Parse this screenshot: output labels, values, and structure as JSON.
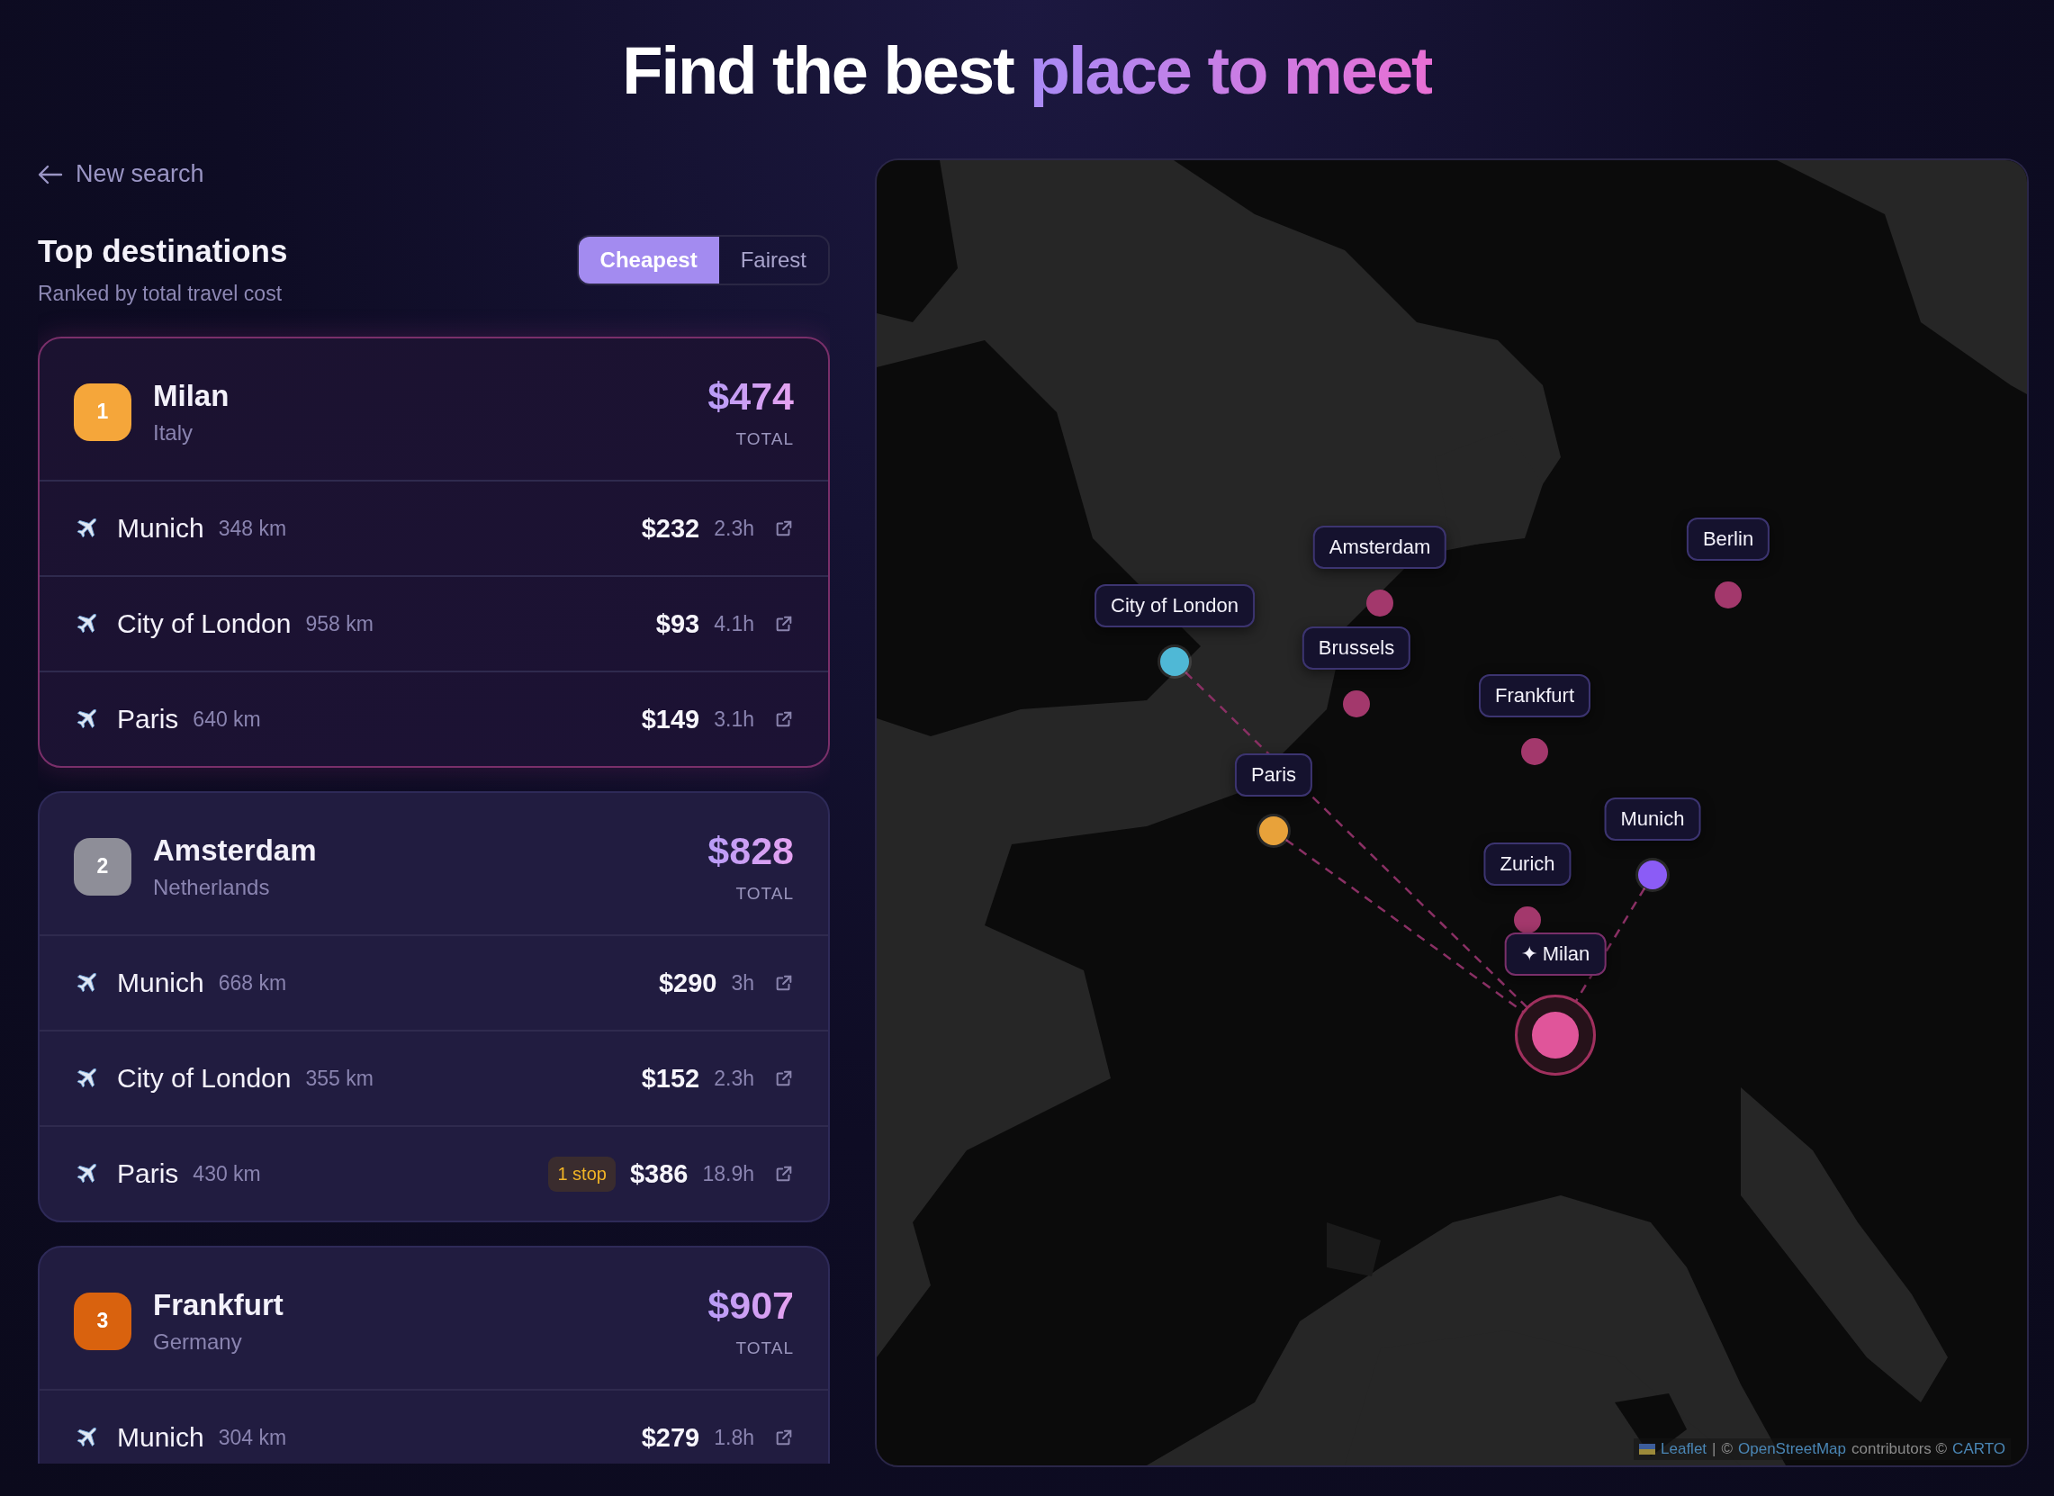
{
  "header": {
    "title": "Find the best",
    "highlight": "place to meet"
  },
  "sidebar": {
    "back_link": "New search",
    "heading": "Top destinations",
    "subheading": "Ranked by total travel cost",
    "sort_tabs": [
      {
        "label": "Cheapest",
        "selected": true
      },
      {
        "label": "Fairest",
        "selected": false
      }
    ],
    "destinations": [
      {
        "rank": "1",
        "color": "#f5a63a",
        "city": "Milan",
        "country": "Italy",
        "total": "$474",
        "total_label": "TOTAL",
        "selected": true,
        "legs": [
          {
            "city": "Munich",
            "distance": "348 km",
            "price": "$232",
            "duration": "2.3h"
          },
          {
            "city": "City of London",
            "distance": "958 km",
            "price": "$93",
            "duration": "4.1h"
          },
          {
            "city": "Paris",
            "distance": "640 km",
            "price": "$149",
            "duration": "3.1h"
          }
        ]
      },
      {
        "rank": "2",
        "color": "#8e8e98",
        "city": "Amsterdam",
        "country": "Netherlands",
        "total": "$828",
        "total_label": "TOTAL",
        "selected": false,
        "legs": [
          {
            "city": "Munich",
            "distance": "668 km",
            "price": "$290",
            "duration": "3h"
          },
          {
            "city": "City of London",
            "distance": "355 km",
            "price": "$152",
            "duration": "2.3h"
          },
          {
            "city": "Paris",
            "distance": "430 km",
            "stops": "1 stop",
            "price": "$386",
            "duration": "18.9h"
          }
        ]
      },
      {
        "rank": "3",
        "color": "#d9620e",
        "city": "Frankfurt",
        "country": "Germany",
        "total": "$907",
        "total_label": "TOTAL",
        "selected": false,
        "legs": [
          {
            "city": "Munich",
            "distance": "304 km",
            "price": "$279",
            "duration": "1.8h"
          }
        ]
      }
    ]
  },
  "map": {
    "markers": [
      {
        "label": "City of London",
        "kind": "origin",
        "color": "#4fb8d6"
      },
      {
        "label": "Amsterdam",
        "kind": "candidate",
        "color": "#a3386c"
      },
      {
        "label": "Brussels",
        "kind": "candidate",
        "color": "#a3386c"
      },
      {
        "label": "Paris",
        "kind": "origin",
        "color": "#e8a23a"
      },
      {
        "label": "Frankfurt",
        "kind": "candidate",
        "color": "#a3386c"
      },
      {
        "label": "Berlin",
        "kind": "candidate",
        "color": "#a3386c"
      },
      {
        "label": "Munich",
        "kind": "origin",
        "color": "#8b5cf6"
      },
      {
        "label": "Zurich",
        "kind": "candidate",
        "color": "#a3386c"
      },
      {
        "label": "✦ Milan",
        "kind": "destination",
        "color": "#e0559a"
      }
    ],
    "attribution": [
      {
        "text": "Leaflet",
        "link": true
      },
      {
        "text": "|",
        "link": false
      },
      {
        "text": "©",
        "link": false
      },
      {
        "text": "OpenStreetMap",
        "link": true
      },
      {
        "text": "contributors ©",
        "link": false
      },
      {
        "text": "CARTO",
        "link": true
      }
    ]
  }
}
